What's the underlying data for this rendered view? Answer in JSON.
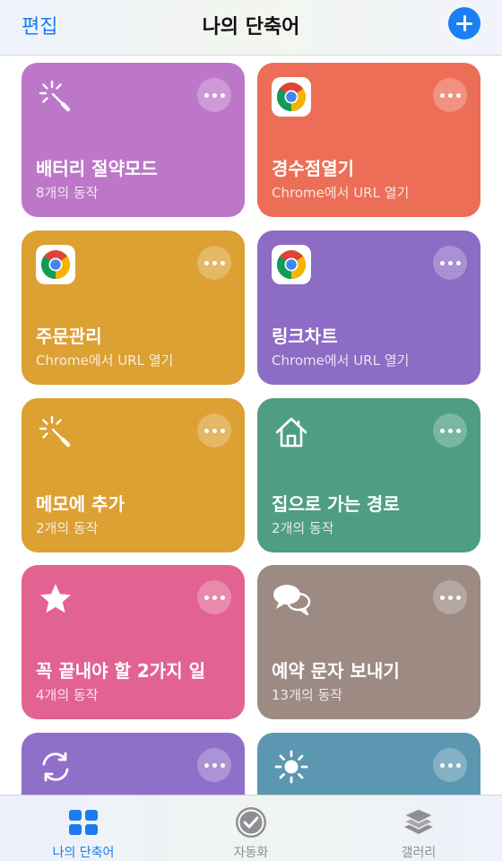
{
  "header": {
    "edit_label": "편집",
    "title": "나의 단축어"
  },
  "cards": [
    {
      "title": "배터리 절약모드",
      "subtitle": "8개의 동작",
      "color": "#bd77c9",
      "icon": "magic-wand-icon"
    },
    {
      "title": "경수점열기",
      "subtitle": "Chrome에서 URL 열기",
      "color": "#ec6e57",
      "icon": "chrome-icon"
    },
    {
      "title": "주문관리",
      "subtitle": "Chrome에서 URL 열기",
      "color": "#dca033",
      "icon": "chrome-icon"
    },
    {
      "title": "링크차트",
      "subtitle": "Chrome에서 URL 열기",
      "color": "#8c6cc4",
      "icon": "chrome-icon"
    },
    {
      "title": "메모에 추가",
      "subtitle": "2개의 동작",
      "color": "#dca033",
      "icon": "magic-wand-icon"
    },
    {
      "title": "집으로 가는 경로",
      "subtitle": "2개의 동작",
      "color": "#4f9e82",
      "icon": "house-icon"
    },
    {
      "title": "꼭 끝내야 할 2가지 일",
      "subtitle": "4개의 동작",
      "color": "#e26391",
      "icon": "star-icon"
    },
    {
      "title": "예약 문자 보내기",
      "subtitle": "13개의 동작",
      "color": "#9c8a83",
      "icon": "speech-bubbles-icon"
    },
    {
      "title": "",
      "subtitle": "",
      "color": "#8f6fc8",
      "icon": "refresh-icon"
    },
    {
      "title": "",
      "subtitle": "",
      "color": "#5b97b0",
      "icon": "sun-icon"
    }
  ],
  "tabbar": {
    "tabs": [
      {
        "label": "나의 단축어",
        "icon": "grid-icon",
        "active": true
      },
      {
        "label": "자동화",
        "icon": "checkmark-clock-icon",
        "active": false
      },
      {
        "label": "갤러리",
        "icon": "layers-icon",
        "active": false
      }
    ]
  },
  "colors": {
    "accent": "#1b7ff2",
    "tab_inactive": "#8e8e93"
  }
}
